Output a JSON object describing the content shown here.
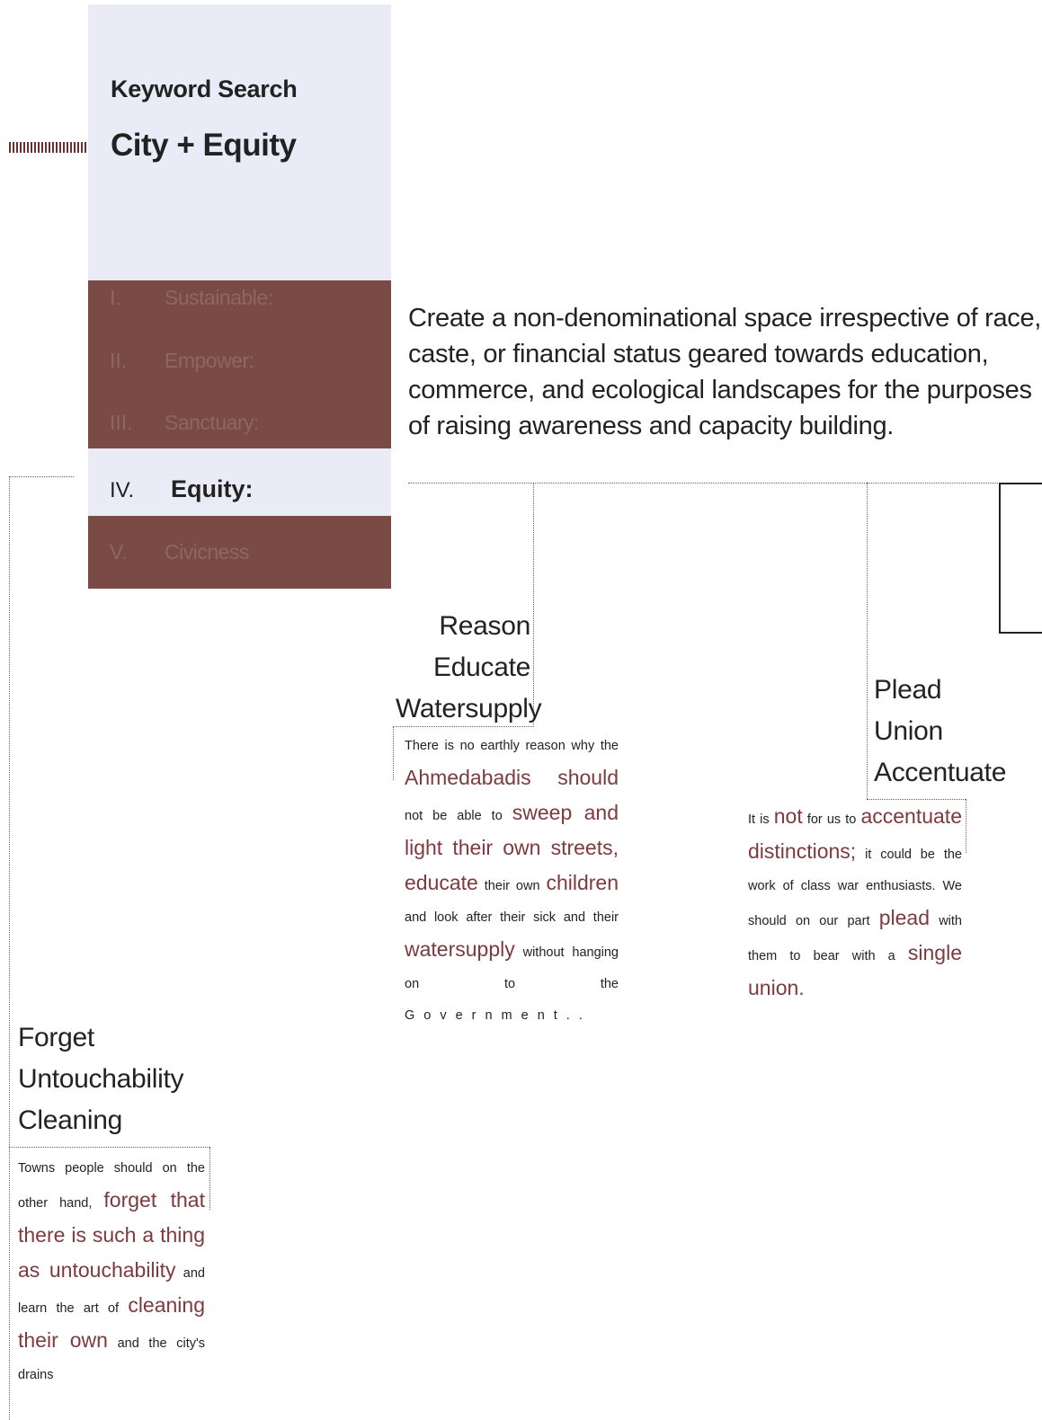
{
  "keyword": {
    "label": "Keyword Search",
    "value": "City + Equity"
  },
  "menu": [
    {
      "num": "I.",
      "label": "Sustainable:",
      "active": false
    },
    {
      "num": "II.",
      "label": "Empower:",
      "active": false
    },
    {
      "num": "III.",
      "label": "Sanctuary:",
      "active": false
    },
    {
      "num": "IV.",
      "label": "Equity:",
      "active": true
    },
    {
      "num": "V.",
      "label": "Civicness",
      "active": false
    }
  ],
  "headline": "Create a non-denominational space irrespective of race, caste, or financial status geared    towards education, commerce, and ecological landscapes for the purposes of raising awareness and capacity building.",
  "blocks": {
    "reason": {
      "keywords": [
        "Reason",
        "Educate",
        "Watersupply"
      ]
    },
    "plead": {
      "keywords": [
        "Plead",
        "Union",
        "Accentuate"
      ]
    },
    "forget": {
      "keywords": [
        "Forget",
        "Untouchability",
        "Cleaning"
      ]
    }
  },
  "colors": {
    "accent": "#7e3a3e",
    "band": "#7a4b45",
    "panel": "#ebebf8"
  }
}
